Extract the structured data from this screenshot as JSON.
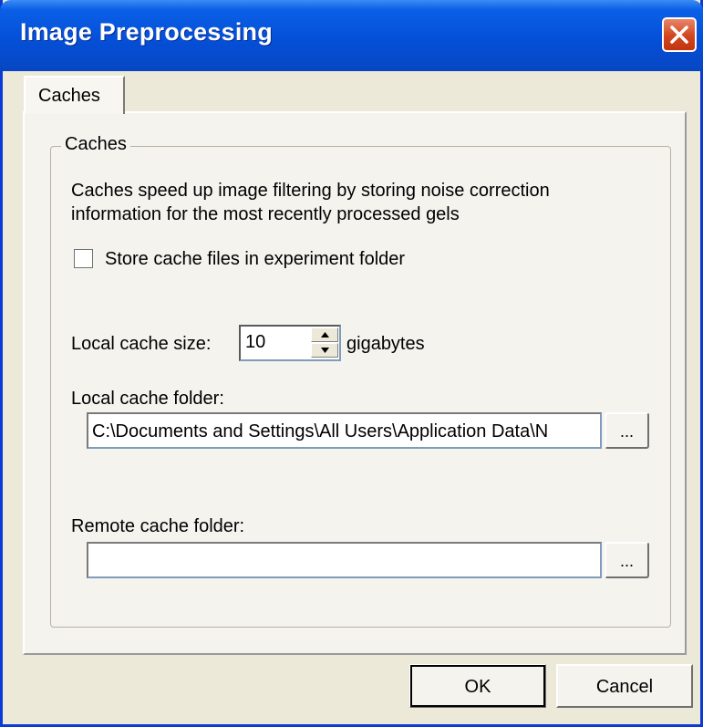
{
  "window": {
    "title": "Image Preprocessing",
    "icons": {
      "close": "close-icon"
    }
  },
  "tabs": [
    {
      "label": "Caches",
      "active": true
    }
  ],
  "caches_group": {
    "title": "Caches",
    "description_line1": "Caches speed up image filtering by storing noise correction",
    "description_line2": "information for the most recently processed gels",
    "store_in_experiment": {
      "label": "Store cache files in experiment folder",
      "checked": false
    },
    "local_cache_size": {
      "label": "Local cache size:",
      "value": "10",
      "unit": "gigabytes"
    },
    "local_cache_folder": {
      "label": "Local cache folder:",
      "value": "C:\\Documents and Settings\\All Users\\Application Data\\N",
      "browse_label": "..."
    },
    "remote_cache_folder": {
      "label": "Remote cache folder:",
      "value": "",
      "browse_label": "..."
    }
  },
  "buttons": {
    "ok": "OK",
    "cancel": "Cancel"
  },
  "colors": {
    "titlebar": "#0550d8",
    "dialog_face": "#ece9d8",
    "close_button": "#d2451f"
  }
}
